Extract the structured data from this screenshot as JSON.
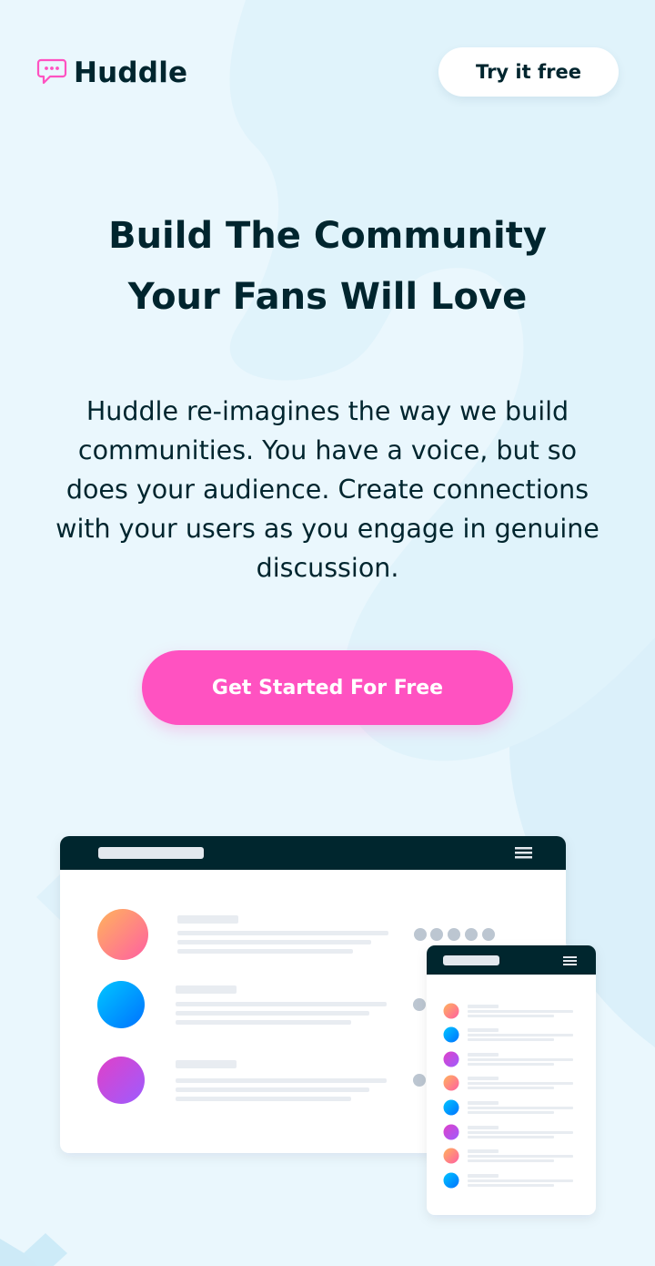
{
  "brand": {
    "name": "Huddle",
    "logo_icon": "chat-bubble-icon",
    "colors": {
      "primary": "#00252e",
      "accent": "#ff52c1",
      "background": "#eaf7fd",
      "logo_pink": "#ff52c1"
    }
  },
  "header": {
    "cta_label": "Try it free"
  },
  "hero": {
    "headline_line1": "Build The Community",
    "headline_line2": "Your Fans Will Love",
    "description": "Huddle re-imagines the way we build communities. You have a voice, but so does your audience. Create connections with your users as you engage in genuine discussion.",
    "cta_label": "Get Started For Free"
  },
  "illustration": {
    "name": "app-mockup-illustration",
    "desktop_avatars": [
      "orange-gradient",
      "blue-gradient",
      "purple-gradient"
    ],
    "mobile_avatars": [
      "orange",
      "blue",
      "purple",
      "orange",
      "blue",
      "purple",
      "orange",
      "blue"
    ]
  }
}
